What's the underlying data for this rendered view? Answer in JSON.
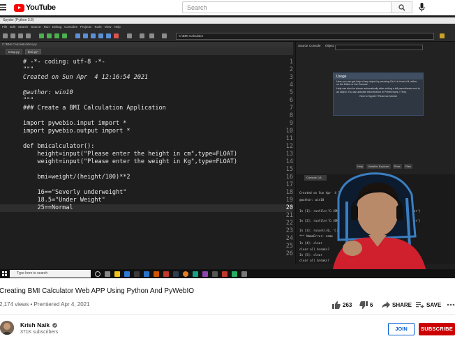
{
  "header": {
    "logo_text": "YouTube",
    "search_placeholder": "Search"
  },
  "spyder": {
    "window_title": "Spyder (Python 3.8)",
    "menu": [
      "File",
      "Edit",
      "Search",
      "Source",
      "Run",
      "Debug",
      "Consoles",
      "Projects",
      "Tools",
      "View",
      "Help"
    ],
    "toolbar_path": "C:\\BMI Calculator",
    "file_path": "C:\\BMI Calculator\\bmi.py",
    "tabs": [
      "temp.py",
      "bmi.py*"
    ],
    "code_lines": [
      {
        "n": "1",
        "t": "# -*- coding: utf-8 -*-"
      },
      {
        "n": "2",
        "t": "\"\"\""
      },
      {
        "n": "3",
        "t": "Created on Sun Apr  4 12:16:54 2021"
      },
      {
        "n": "4",
        "t": ""
      },
      {
        "n": "5",
        "t": "@author: win10"
      },
      {
        "n": "6",
        "t": "\"\"\""
      },
      {
        "n": "7",
        "t": "### Create a BMI Calculation Application"
      },
      {
        "n": "8",
        "t": ""
      },
      {
        "n": "9",
        "t": "import pywebio.input import *"
      },
      {
        "n": "10",
        "t": "import pywebio.output import *"
      },
      {
        "n": "11",
        "t": ""
      },
      {
        "n": "12",
        "t": "def bmicalculator():"
      },
      {
        "n": "13",
        "t": "    height=input(\"Please enter the height in cm\",type=FLOAT)"
      },
      {
        "n": "14",
        "t": "    weight=input(\"Please enter the weight in Kg\",type=FLOAT)"
      },
      {
        "n": "15",
        "t": ""
      },
      {
        "n": "16",
        "t": "    bmi=weight/(height/100)**2"
      },
      {
        "n": "17",
        "t": ""
      },
      {
        "n": "18",
        "t": "    16==\"Severly underweight\""
      },
      {
        "n": "19",
        "t": "    18.5=\"Under Weight\""
      },
      {
        "n": "20",
        "t": "    25==Normal"
      },
      {
        "n": "21",
        "t": ""
      },
      {
        "n": "22",
        "t": ""
      },
      {
        "n": "23",
        "t": ""
      },
      {
        "n": "24",
        "t": ""
      },
      {
        "n": "25",
        "t": ""
      },
      {
        "n": "26",
        "t": ""
      }
    ],
    "right_tabs": [
      "Source",
      "Console",
      "Object"
    ],
    "help": {
      "title": "Usage",
      "p1": "Here you can get help of any object by pressing Ctrl+I in front of it, either on the Editor or the Console.",
      "p2": "Help can also be shown automatically after writing a left parenthesis next to an object. You can activate this behavior in Preferences > Help.",
      "p3": "New to Spyder? Read our tutorial"
    },
    "bottom_tabs": [
      "Help",
      "Variable Explorer",
      "Plots",
      "Files"
    ],
    "console_tab": "Console 1/A",
    "console_lines": [
      "Created on Sun Apr  4 12:16:54 2021",
      "@author: win10",
      "In [1]: runfile('C:/BMI Calculator/bmi.py', wdir='C:/BMI Calculator')",
      "In [2]: runfile('C:/BMI Calculator/bmi.py', wdir='C:/BMI Calculator')",
      "In [3]: runcell(0, 'C:/BMI Calculator/bmi.py')",
      "*** NameError: name",
      "In [4]: clear",
      "clear all breaks?",
      "In [5]: clear",
      "clear all breaks?"
    ],
    "taskbar_search": "Type here to search"
  },
  "video": {
    "title": "Creating BMI Calculator Web APP Using Python And PyWebIO",
    "meta": "2,174 views • Premiered Apr 4, 2021",
    "likes": "263",
    "dislikes": "6",
    "share": "SHARE",
    "save": "SAVE"
  },
  "channel": {
    "name": "Krish Naik",
    "subscribers": "371K subscribers",
    "join": "JOIN",
    "subscribe": "SUBSCRIBE"
  },
  "colors": {
    "brand_red": "#ff0000",
    "subscribe_red": "#cc0000",
    "join_blue": "#065fd4"
  }
}
